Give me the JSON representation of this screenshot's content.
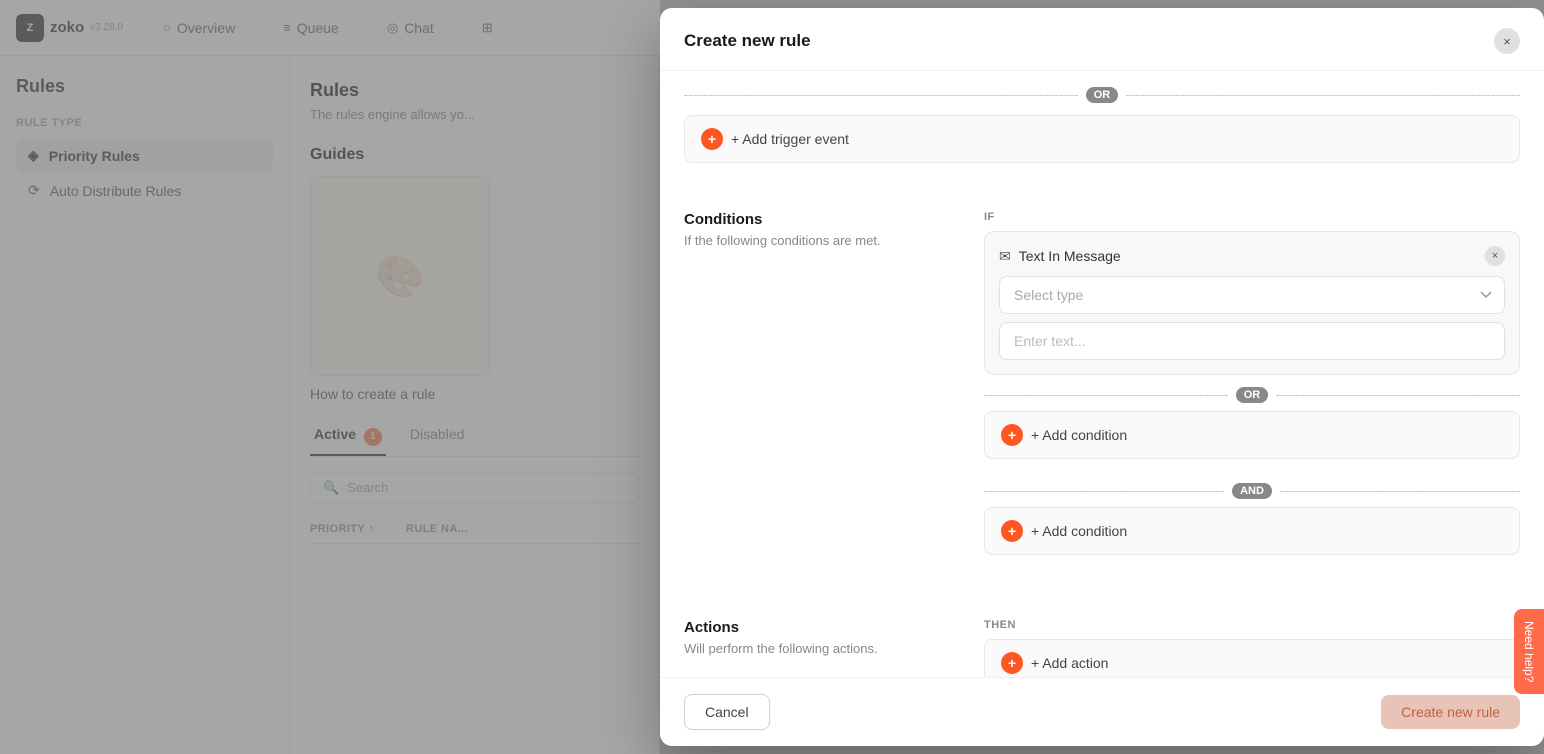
{
  "app": {
    "logo_text": "zoko",
    "version": "v3.28.0",
    "logo_box_char": "Z"
  },
  "nav": {
    "items": [
      {
        "id": "overview",
        "label": "Overview",
        "icon": "○"
      },
      {
        "id": "queue",
        "label": "Queue",
        "icon": "≡"
      },
      {
        "id": "chat",
        "label": "Chat",
        "icon": "◎"
      },
      {
        "id": "grid",
        "label": "",
        "icon": "⊞"
      }
    ]
  },
  "sidebar": {
    "title": "Rules",
    "section_label": "RULE TYPE",
    "items": [
      {
        "id": "priority-rules",
        "label": "Priority Rules",
        "icon": "◈",
        "active": true
      },
      {
        "id": "auto-distribute",
        "label": "Auto Distribute Rules",
        "icon": "⟳",
        "active": false
      }
    ]
  },
  "main": {
    "title": "Rules",
    "subtitle": "The rules engine allows yo...",
    "guides_title": "Guides",
    "guide_link": "How to create a rule",
    "tabs": [
      {
        "id": "active",
        "label": "Active",
        "badge": "1",
        "active": true
      },
      {
        "id": "disabled",
        "label": "Disabled",
        "active": false
      }
    ],
    "search_placeholder": "Search",
    "table_headers": [
      "PRIORITY ↑",
      "RULE NA..."
    ]
  },
  "modal": {
    "title": "Create new rule",
    "close_label": "×",
    "sections": {
      "conditions": {
        "title": "Conditions",
        "description": "If the following conditions are met.",
        "if_label": "IF",
        "or_label": "OR",
        "and_label": "AND",
        "condition": {
          "type_label": "Text In Message",
          "type_icon": "✉",
          "remove_label": "×",
          "select_placeholder": "Select type",
          "text_placeholder": "Enter text..."
        },
        "add_condition_or_label": "+ Add condition",
        "add_condition_and_label": "+ Add condition"
      },
      "trigger": {
        "or_label": "OR",
        "add_trigger_label": "+ Add trigger event"
      },
      "actions": {
        "title": "Actions",
        "description": "Will perform the following actions.",
        "then_label": "THEN",
        "add_action_label": "+ Add action"
      }
    },
    "footer": {
      "cancel_label": "Cancel",
      "create_label": "Create new rule"
    }
  },
  "help": {
    "label": "Need help?"
  }
}
